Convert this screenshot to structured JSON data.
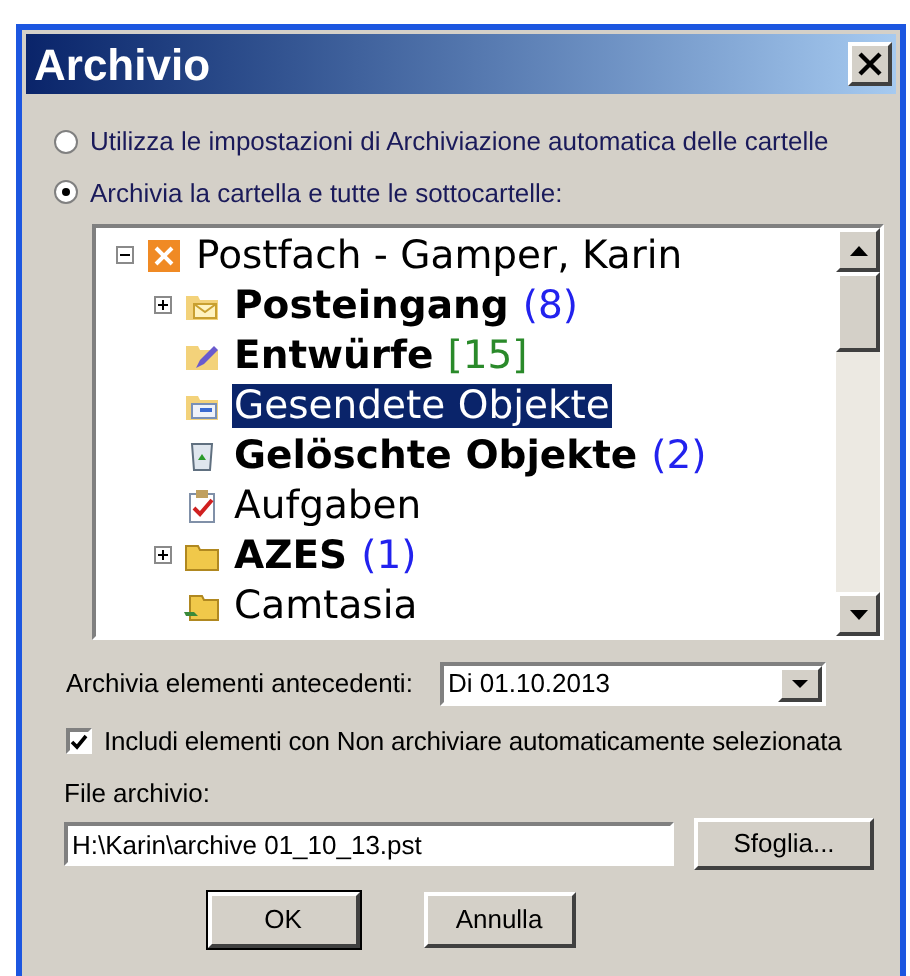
{
  "window": {
    "title": "Archivio"
  },
  "options": [
    {
      "label": "Utilizza le impostazioni di Archiviazione automatica delle cartelle",
      "selected": false
    },
    {
      "label": "Archivia la cartella e tutte le sottocartelle:",
      "selected": true
    }
  ],
  "tree": {
    "root": {
      "label": "Postfach - Gamper, Karin",
      "kind": "mailbox",
      "expanded": true,
      "bold": false,
      "selected": false,
      "children": [
        {
          "label": "Posteingang",
          "count": "(8)",
          "color": "#2222ee",
          "kind": "inbox",
          "bold": true,
          "selected": false,
          "expandable": true
        },
        {
          "label": "Entwürfe",
          "count": "[15]",
          "color": "#2a8a2a",
          "kind": "drafts",
          "bold": true,
          "selected": false,
          "expandable": false
        },
        {
          "label": "Gesendete Objekte",
          "kind": "sent",
          "bold": false,
          "selected": true,
          "expandable": false
        },
        {
          "label": "Gelöschte Objekte",
          "count": "(2)",
          "color": "#2222ee",
          "kind": "trash",
          "bold": true,
          "selected": false,
          "expandable": false
        },
        {
          "label": "Aufgaben",
          "kind": "tasks",
          "bold": false,
          "selected": false,
          "expandable": false
        },
        {
          "label": "AZES",
          "count": "(1)",
          "color": "#2222ee",
          "kind": "folder",
          "bold": true,
          "selected": false,
          "expandable": true
        },
        {
          "label": "Camtasia",
          "kind": "shared-folder",
          "bold": false,
          "selected": false,
          "expandable": false
        }
      ]
    }
  },
  "date": {
    "label": "Archivia elementi antecedenti:",
    "value": "Di 01.10.2013"
  },
  "include": {
    "label": "Includi elementi con Non archiviare automaticamente selezionata",
    "checked": true
  },
  "file": {
    "label": "File archivio:",
    "value": "H:\\Karin\\archive 01_10_13.pst",
    "browse": "Sfoglia..."
  },
  "buttons": [
    "OK",
    "Annulla"
  ]
}
